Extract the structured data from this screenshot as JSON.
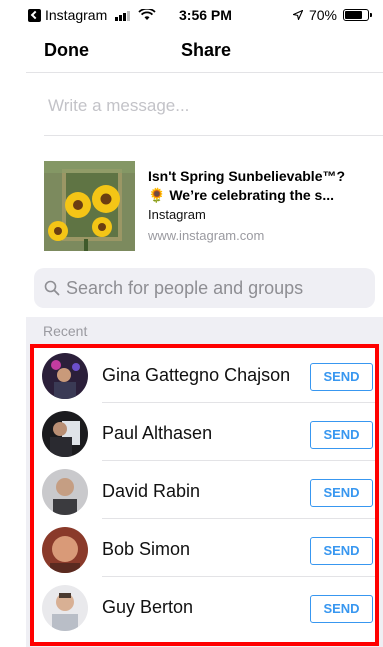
{
  "status_bar": {
    "carrier": "Instagram",
    "time": "3:56 PM",
    "battery": "70%",
    "battery_level": 0.7
  },
  "nav": {
    "done_label": "Done",
    "title": "Share"
  },
  "message": {
    "placeholder": "Write a message..."
  },
  "preview": {
    "title": "Isn't Spring Sunbelievable™?",
    "subtitle": "🌻 We’re celebrating the s...",
    "site": "Instagram",
    "url": "www.instagram.com"
  },
  "search": {
    "placeholder": "Search for people and groups"
  },
  "recent": {
    "label": "Recent",
    "contacts": [
      {
        "name": "Gina Gattegno Chajson",
        "send_label": "SEND"
      },
      {
        "name": "Paul Althasen",
        "send_label": "SEND"
      },
      {
        "name": "David Rabin",
        "send_label": "SEND"
      },
      {
        "name": "Bob Simon",
        "send_label": "SEND"
      },
      {
        "name": "Guy Berton",
        "send_label": "SEND"
      }
    ]
  },
  "colors": {
    "accent": "#3897f0",
    "highlight": "#ff0000",
    "band": "#efeff4"
  }
}
